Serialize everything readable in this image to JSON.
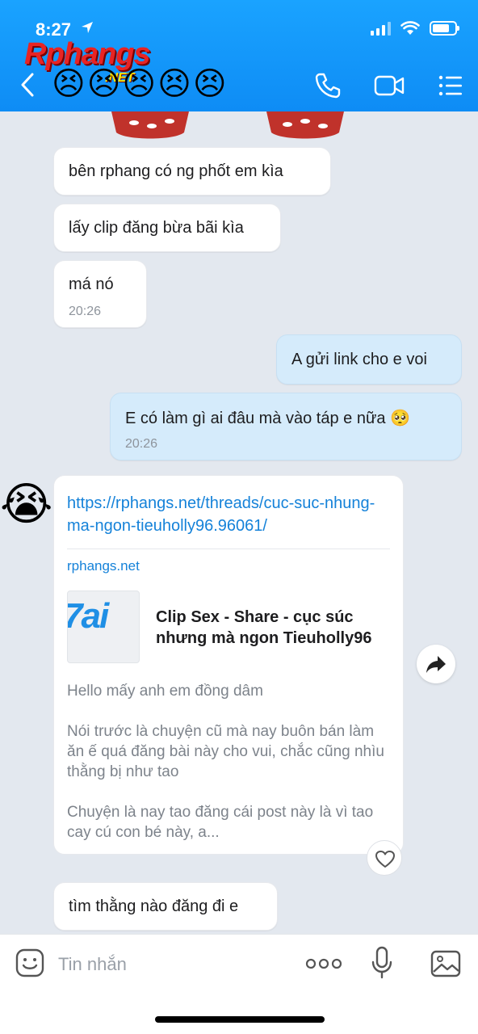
{
  "status_bar": {
    "time": "8:27"
  },
  "watermark": {
    "brand": "Rphangs",
    "suffix": ".NET"
  },
  "header": {
    "title_emojis": [
      "😣",
      "😣",
      "😣",
      "😣",
      "😣"
    ]
  },
  "messages": [
    {
      "dir": "in",
      "text": "bên rphang có ng phốt em kìa"
    },
    {
      "dir": "in",
      "text": "lấy clip đăng bừa bãi kìa"
    },
    {
      "dir": "in",
      "text": "má nó",
      "time": "20:26"
    },
    {
      "dir": "out",
      "text": "A gửi link cho e voi"
    },
    {
      "dir": "out",
      "text": "E có làm gì ai đâu mà vào táp e nữa",
      "emoji": "🥺",
      "time": "20:26"
    }
  ],
  "sender_avatar": "😭",
  "link_card": {
    "url": "https://rphangs.net/threads/cuc-suc-nhung-ma-ngon-tieuholly96.96061/",
    "domain": "rphangs.net",
    "thumb_text": "7ai",
    "title": "Clip Sex - Share - cục súc nhưng mà ngon Tieuholly96",
    "desc_1": "Hello mấy anh em đồng dâm",
    "desc_2": "Nói trước là chuyện cũ mà nay buôn bán làm ăn ế quá đăng bài này cho vui, chắc cũng nhìu thằng bị như tao",
    "desc_3": "Chuyện là nay tao đăng cái post này là vì tao cay cú con bé này, a..."
  },
  "last_message": {
    "dir": "in",
    "text": "tìm thằng nào đăng đi e"
  },
  "composer": {
    "placeholder": "Tin nhắn"
  },
  "icons": {
    "back": "back-chevron-icon",
    "call": "phone-icon",
    "video": "video-camera-icon",
    "menu": "menu-list-icon",
    "share": "share-forward-icon",
    "react": "heart-icon",
    "sticker": "sticker-smile-icon",
    "more": "more-dots-icon",
    "mic": "microphone-icon",
    "image": "image-gallery-icon"
  },
  "colors": {
    "header": "#0e8cf5",
    "background": "#e3e8ef",
    "outgoing_bubble": "#d5ebfb",
    "link": "#1582d9"
  }
}
